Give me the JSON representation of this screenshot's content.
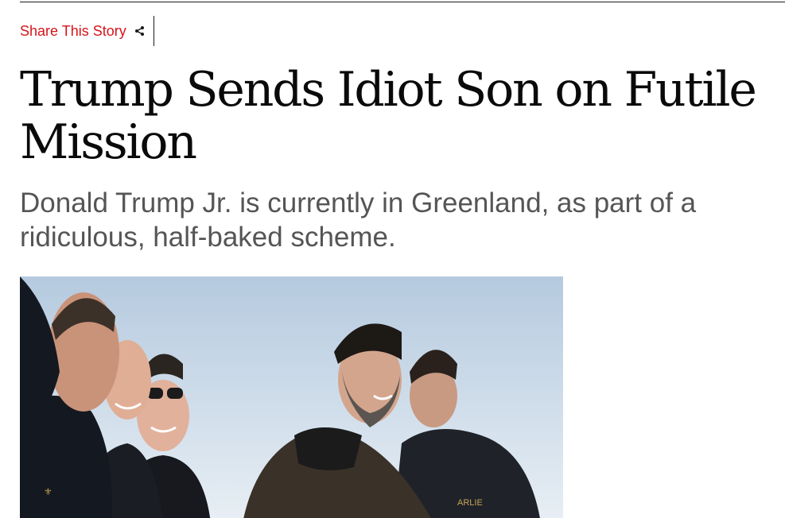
{
  "share": {
    "label": "Share This Story",
    "icon": "share-icon"
  },
  "article": {
    "headline": "Trump Sends Idiot Son on Futile Mission",
    "dek": "Donald Trump Jr. is currently in Greenland, as part of a ridiculous, half-baked scheme."
  },
  "hero_image": {
    "description_icon": "photo",
    "badge_text": "ARLIE"
  },
  "colors": {
    "accent": "#d6141a",
    "headline": "#0a0a0a",
    "dek": "#555555",
    "sky_top": "#b9cde1",
    "sky_bottom": "#e6edf3"
  }
}
